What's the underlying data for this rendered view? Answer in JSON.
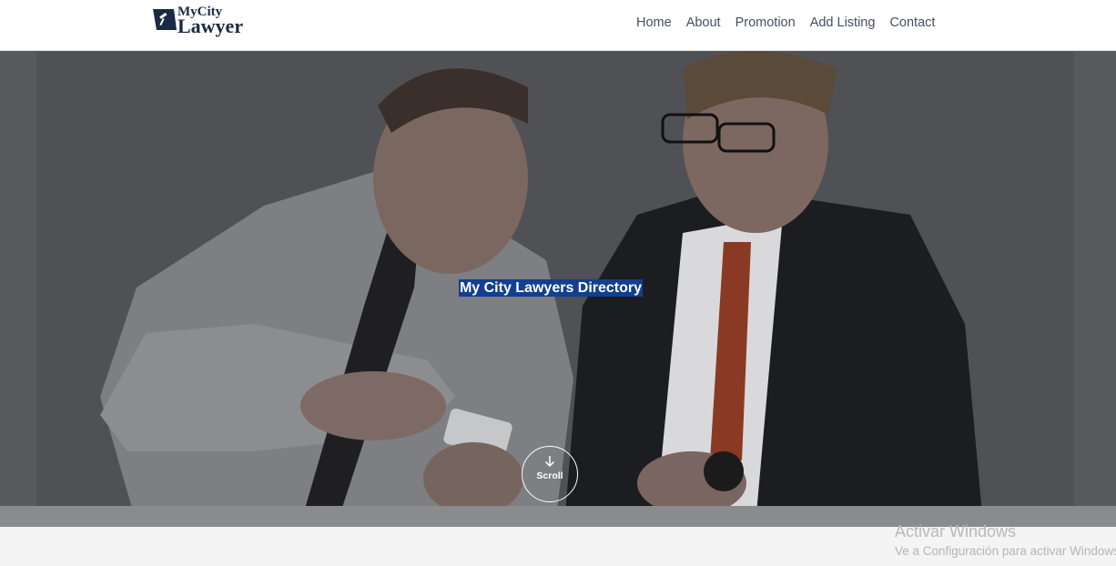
{
  "brand": {
    "top": "MyCity",
    "bottom": "Lawyer",
    "colors": {
      "navy": "#1a2a44"
    }
  },
  "nav": {
    "items": [
      {
        "label": "Home"
      },
      {
        "label": "About"
      },
      {
        "label": "Promotion"
      },
      {
        "label": "Add Listing"
      },
      {
        "label": "Contact"
      }
    ]
  },
  "hero": {
    "title": "My City Lawyers Directory",
    "highlight_color": "#123f92",
    "scroll_label": "Scroll",
    "scroll_icon": "arrow-down-icon"
  },
  "watermark": {
    "title": "Activar Windows",
    "subtitle": "Ve a Configuración para activar Windows."
  }
}
